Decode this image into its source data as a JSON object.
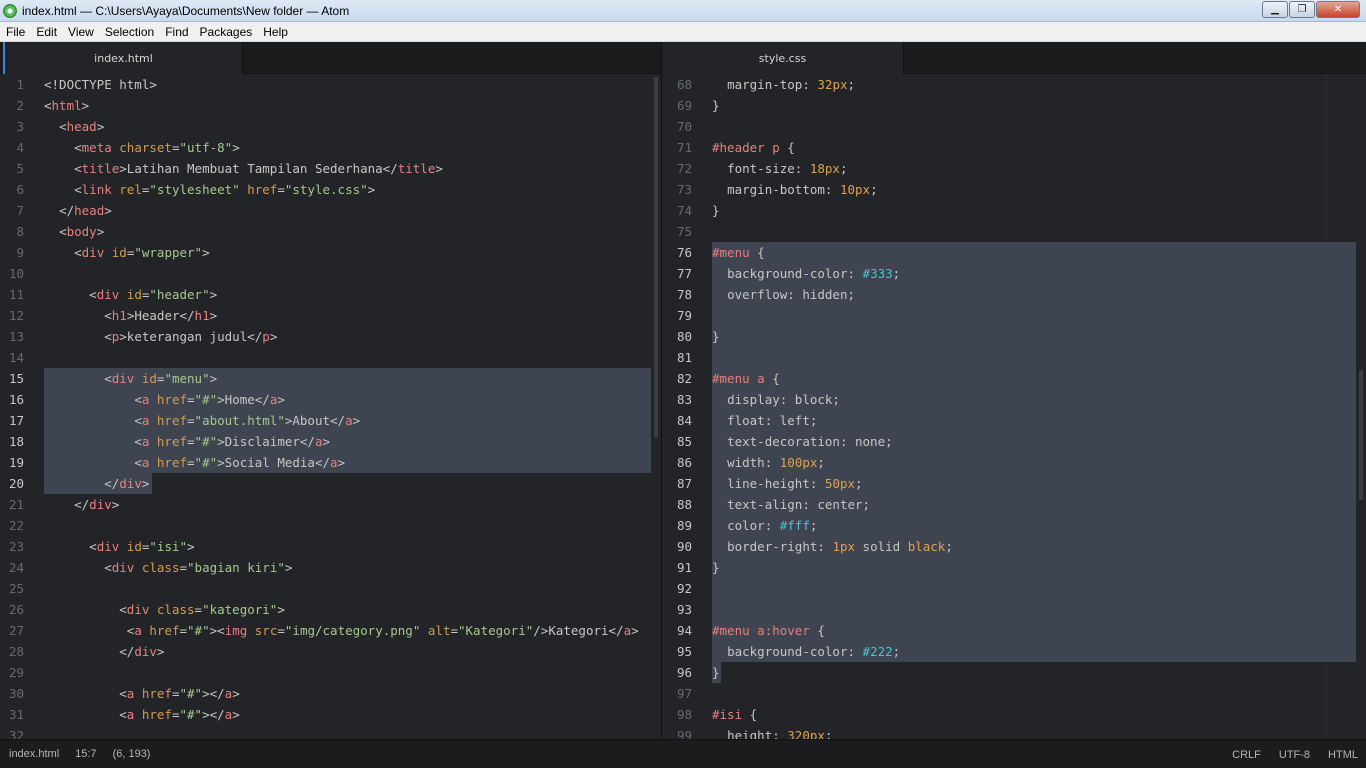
{
  "window": {
    "title": "index.html — C:\\Users\\Ayaya\\Documents\\New folder — Atom"
  },
  "menu": [
    "File",
    "Edit",
    "View",
    "Selection",
    "Find",
    "Packages",
    "Help"
  ],
  "left_pane": {
    "tab": "index.html",
    "lines": [
      {
        "n": "1",
        "html": "<span class='t-txt'>&lt;!DOCTYPE html&gt;</span>"
      },
      {
        "n": "2",
        "html": "<span class='t-txt'>&lt;</span><span class='t-tag'>html</span><span class='t-txt'>&gt;</span>"
      },
      {
        "n": "3",
        "html": "  <span class='t-txt'>&lt;</span><span class='t-tag'>head</span><span class='t-txt'>&gt;</span>"
      },
      {
        "n": "4",
        "html": "    <span class='t-txt'>&lt;</span><span class='t-tag'>meta</span> <span class='t-attr'>charset</span><span class='t-txt'>=</span><span class='t-str'>\"utf-8\"</span><span class='t-txt'>&gt;</span>"
      },
      {
        "n": "5",
        "html": "    <span class='t-txt'>&lt;</span><span class='t-tag'>title</span><span class='t-txt'>&gt;Latihan Membuat Tampilan Sederhana&lt;/</span><span class='t-tag'>title</span><span class='t-txt'>&gt;</span>"
      },
      {
        "n": "6",
        "html": "    <span class='t-txt'>&lt;</span><span class='t-tag'>link</span> <span class='t-attr'>rel</span><span class='t-txt'>=</span><span class='t-str'>\"stylesheet\"</span> <span class='t-attr'>href</span><span class='t-txt'>=</span><span class='t-str'>\"style.css\"</span><span class='t-txt'>&gt;</span>"
      },
      {
        "n": "7",
        "html": "  <span class='t-txt'>&lt;/</span><span class='t-tag'>head</span><span class='t-txt'>&gt;</span>"
      },
      {
        "n": "8",
        "html": "  <span class='t-txt'>&lt;</span><span class='t-tag'>body</span><span class='t-txt'>&gt;</span>"
      },
      {
        "n": "9",
        "html": "    <span class='t-txt'>&lt;</span><span class='t-tag'>div</span> <span class='t-attr'>id</span><span class='t-txt'>=</span><span class='t-str'>\"wrapper\"</span><span class='t-txt'>&gt;</span>"
      },
      {
        "n": "10",
        "html": ""
      },
      {
        "n": "11",
        "html": "      <span class='t-txt'>&lt;</span><span class='t-tag'>div</span> <span class='t-attr'>id</span><span class='t-txt'>=</span><span class='t-str'>\"header\"</span><span class='t-txt'>&gt;</span>"
      },
      {
        "n": "12",
        "html": "        <span class='t-txt'>&lt;</span><span class='t-tag'>h1</span><span class='t-txt'>&gt;Header&lt;/</span><span class='t-tag'>h1</span><span class='t-txt'>&gt;</span>"
      },
      {
        "n": "13",
        "html": "        <span class='t-txt'>&lt;</span><span class='t-tag'>p</span><span class='t-txt'>&gt;keterangan judul&lt;/</span><span class='t-tag'>p</span><span class='t-txt'>&gt;</span>"
      },
      {
        "n": "14",
        "html": ""
      },
      {
        "n": "15",
        "html": "        <span class='t-txt'>&lt;</span><span class='t-tag'>div</span> <span class='t-attr'>id</span><span class='t-txt'>=</span><span class='t-str'>\"menu\"</span><span class='t-txt'>&gt;</span>"
      },
      {
        "n": "16",
        "html": "            <span class='t-txt'>&lt;</span><span class='t-tag'>a</span> <span class='t-attr'>href</span><span class='t-txt'>=</span><span class='t-str'>\"#\"</span><span class='t-txt'>&gt;Home&lt;/</span><span class='t-tag'>a</span><span class='t-txt'>&gt;</span>"
      },
      {
        "n": "17",
        "html": "            <span class='t-txt'>&lt;</span><span class='t-tag'>a</span> <span class='t-attr'>href</span><span class='t-txt'>=</span><span class='t-str'>\"about.html\"</span><span class='t-txt'>&gt;About&lt;/</span><span class='t-tag'>a</span><span class='t-txt'>&gt;</span>"
      },
      {
        "n": "18",
        "html": "            <span class='t-txt'>&lt;</span><span class='t-tag'>a</span> <span class='t-attr'>href</span><span class='t-txt'>=</span><span class='t-str'>\"#\"</span><span class='t-txt'>&gt;Disclaimer&lt;/</span><span class='t-tag'>a</span><span class='t-txt'>&gt;</span>"
      },
      {
        "n": "19",
        "html": "            <span class='t-txt'>&lt;</span><span class='t-tag'>a</span> <span class='t-attr'>href</span><span class='t-txt'>=</span><span class='t-str'>\"#\"</span><span class='t-txt'>&gt;Social Media&lt;/</span><span class='t-tag'>a</span><span class='t-txt'>&gt;</span>"
      },
      {
        "n": "20",
        "html": "        <span class='t-txt'>&lt;/</span><span class='t-tag'>div</span><span class='t-txt'>&gt;</span>"
      },
      {
        "n": "21",
        "html": "    <span class='t-txt'>&lt;/</span><span class='t-tag'>div</span><span class='t-txt'>&gt;</span>"
      },
      {
        "n": "22",
        "html": ""
      },
      {
        "n": "23",
        "html": "      <span class='t-txt'>&lt;</span><span class='t-tag'>div</span> <span class='t-attr'>id</span><span class='t-txt'>=</span><span class='t-str'>\"isi\"</span><span class='t-txt'>&gt;</span>"
      },
      {
        "n": "24",
        "html": "        <span class='t-txt'>&lt;</span><span class='t-tag'>div</span> <span class='t-attr'>class</span><span class='t-txt'>=</span><span class='t-str'>\"bagian kiri\"</span><span class='t-txt'>&gt;</span>"
      },
      {
        "n": "25",
        "html": ""
      },
      {
        "n": "26",
        "html": "          <span class='t-txt'>&lt;</span><span class='t-tag'>div</span> <span class='t-attr'>class</span><span class='t-txt'>=</span><span class='t-str'>\"kategori\"</span><span class='t-txt'>&gt;</span>"
      },
      {
        "n": "27",
        "html": "           <span class='t-txt'>&lt;</span><span class='t-tag'>a</span> <span class='t-attr'>href</span><span class='t-txt'>=</span><span class='t-str'>\"#\"</span><span class='t-txt'>&gt;&lt;</span><span class='t-tag'>img</span> <span class='t-attr'>src</span><span class='t-txt'>=</span><span class='t-str'>\"img/category.png\"</span> <span class='t-attr'>alt</span><span class='t-txt'>=</span><span class='t-str'>\"Kategori\"</span><span class='t-txt'>/&gt;Kategori&lt;/</span><span class='t-tag'>a</span><span class='t-txt'>&gt;</span>"
      },
      {
        "n": "28",
        "html": "          <span class='t-txt'>&lt;/</span><span class='t-tag'>div</span><span class='t-txt'>&gt;</span>"
      },
      {
        "n": "29",
        "html": ""
      },
      {
        "n": "30",
        "html": "          <span class='t-txt'>&lt;</span><span class='t-tag'>a</span> <span class='t-attr'>href</span><span class='t-txt'>=</span><span class='t-str'>\"#\"</span><span class='t-txt'>&gt;&lt;/</span><span class='t-tag'>a</span><span class='t-txt'>&gt;</span>"
      },
      {
        "n": "31",
        "html": "          <span class='t-txt'>&lt;</span><span class='t-tag'>a</span> <span class='t-attr'>href</span><span class='t-txt'>=</span><span class='t-str'>\"#\"</span><span class='t-txt'>&gt;&lt;/</span><span class='t-tag'>a</span><span class='t-txt'>&gt;</span>"
      },
      {
        "n": "32",
        "html": ""
      }
    ]
  },
  "right_pane": {
    "tab": "style.css",
    "lines": [
      {
        "n": "68",
        "html": "  <span class='t-prop'>margin-top</span>: <span class='t-num'>32px</span>;"
      },
      {
        "n": "69",
        "html": "}"
      },
      {
        "n": "70",
        "html": ""
      },
      {
        "n": "71",
        "html": "<span class='t-sel'>#header</span> <span class='t-sel'>p</span> {"
      },
      {
        "n": "72",
        "html": "  <span class='t-prop'>font-size</span>: <span class='t-num'>18px</span>;"
      },
      {
        "n": "73",
        "html": "  <span class='t-prop'>margin-bottom</span>: <span class='t-num'>10px</span>;"
      },
      {
        "n": "74",
        "html": "}"
      },
      {
        "n": "75",
        "html": ""
      },
      {
        "n": "76",
        "html": "<span class='t-sel'>#menu</span> {"
      },
      {
        "n": "77",
        "html": "  <span class='t-prop'>background-color</span>: <span class='t-hex'>#333</span>;"
      },
      {
        "n": "78",
        "html": "  <span class='t-prop'>overflow</span>: hidden;"
      },
      {
        "n": "79",
        "html": ""
      },
      {
        "n": "80",
        "html": "}"
      },
      {
        "n": "81",
        "html": ""
      },
      {
        "n": "82",
        "html": "<span class='t-sel'>#menu</span> <span class='t-sel'>a</span> {"
      },
      {
        "n": "83",
        "html": "  <span class='t-prop'>display</span>: block;"
      },
      {
        "n": "84",
        "html": "  <span class='t-prop'>float</span>: left;"
      },
      {
        "n": "85",
        "html": "  <span class='t-prop'>text-decoration</span>: none;"
      },
      {
        "n": "86",
        "html": "  <span class='t-prop'>width</span>: <span class='t-num'>100px</span>;"
      },
      {
        "n": "87",
        "html": "  <span class='t-prop'>line-height</span>: <span class='t-num'>50px</span>;"
      },
      {
        "n": "88",
        "html": "  <span class='t-prop'>text-align</span>: center;"
      },
      {
        "n": "89",
        "html": "  <span class='t-prop'>color</span>: <span class='t-hex'>#fff</span>;"
      },
      {
        "n": "90",
        "html": "  <span class='t-prop'>border-right</span>: <span class='t-num'>1px</span> solid <span class='t-num'>black</span>;"
      },
      {
        "n": "91",
        "html": "}"
      },
      {
        "n": "92",
        "html": ""
      },
      {
        "n": "93",
        "html": ""
      },
      {
        "n": "94",
        "html": "<span class='t-sel'>#menu</span> <span class='t-sel'>a:hover</span> {"
      },
      {
        "n": "95",
        "html": "  <span class='t-prop'>background-color</span>: <span class='t-hex'>#222</span>;"
      },
      {
        "n": "96",
        "html": "}"
      },
      {
        "n": "97",
        "html": ""
      },
      {
        "n": "98",
        "html": "<span class='t-sel'>#isi</span> {"
      },
      {
        "n": "99",
        "html": "  <span class='t-prop'>height</span>: <span class='t-num'>320px</span>;"
      }
    ]
  },
  "status": {
    "file": "index.html",
    "cursor": "15:7",
    "selection": "(6, 193)",
    "line_ending": "CRLF",
    "encoding": "UTF-8",
    "grammar": "HTML"
  }
}
